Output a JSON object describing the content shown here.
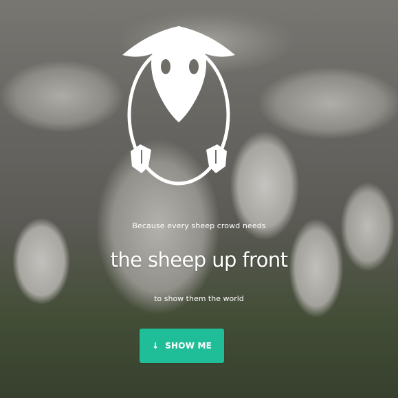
{
  "hero": {
    "background_image": "flock-of-sheep-photo",
    "logo": "sheep-head-icon",
    "tagline_top": "Because every sheep crowd needs",
    "headline": "the sheep up front",
    "tagline_bottom": "to show them the world",
    "cta": {
      "icon": "arrow-down-icon",
      "label": "SHOW ME",
      "color": "#1fbe98"
    }
  }
}
